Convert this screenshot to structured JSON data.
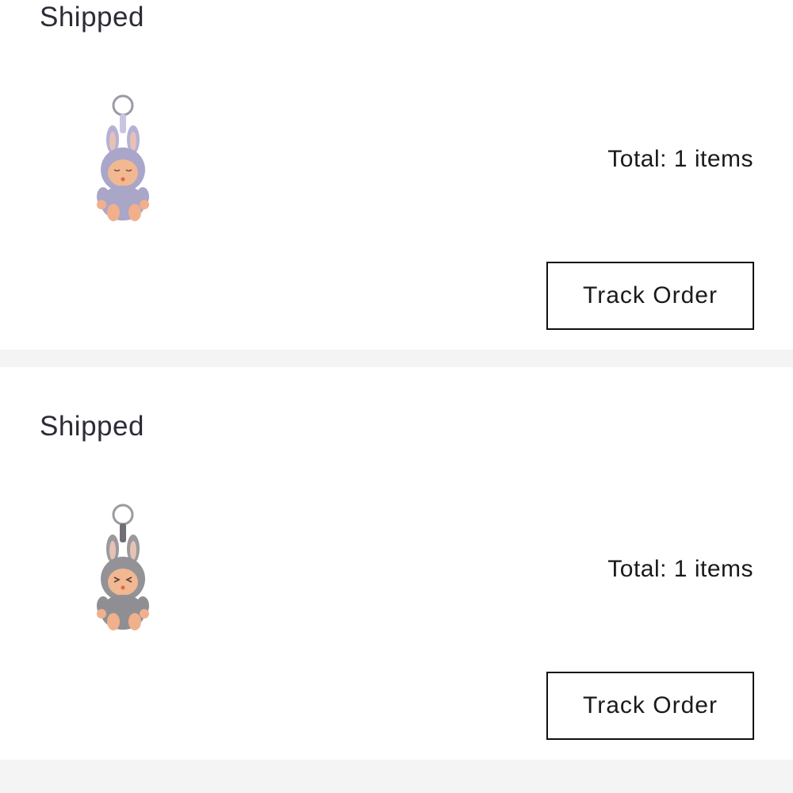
{
  "orders": [
    {
      "status": "Shipped",
      "product_icon": "labubu-keychain-purple-icon",
      "product_color": "#a9a6c8",
      "total": "Total: 1 items",
      "track_label": "Track Order"
    },
    {
      "status": "Shipped",
      "product_icon": "labubu-keychain-grey-icon",
      "product_color": "#8f8f93",
      "total": "Total: 1 items",
      "track_label": "Track Order"
    }
  ]
}
